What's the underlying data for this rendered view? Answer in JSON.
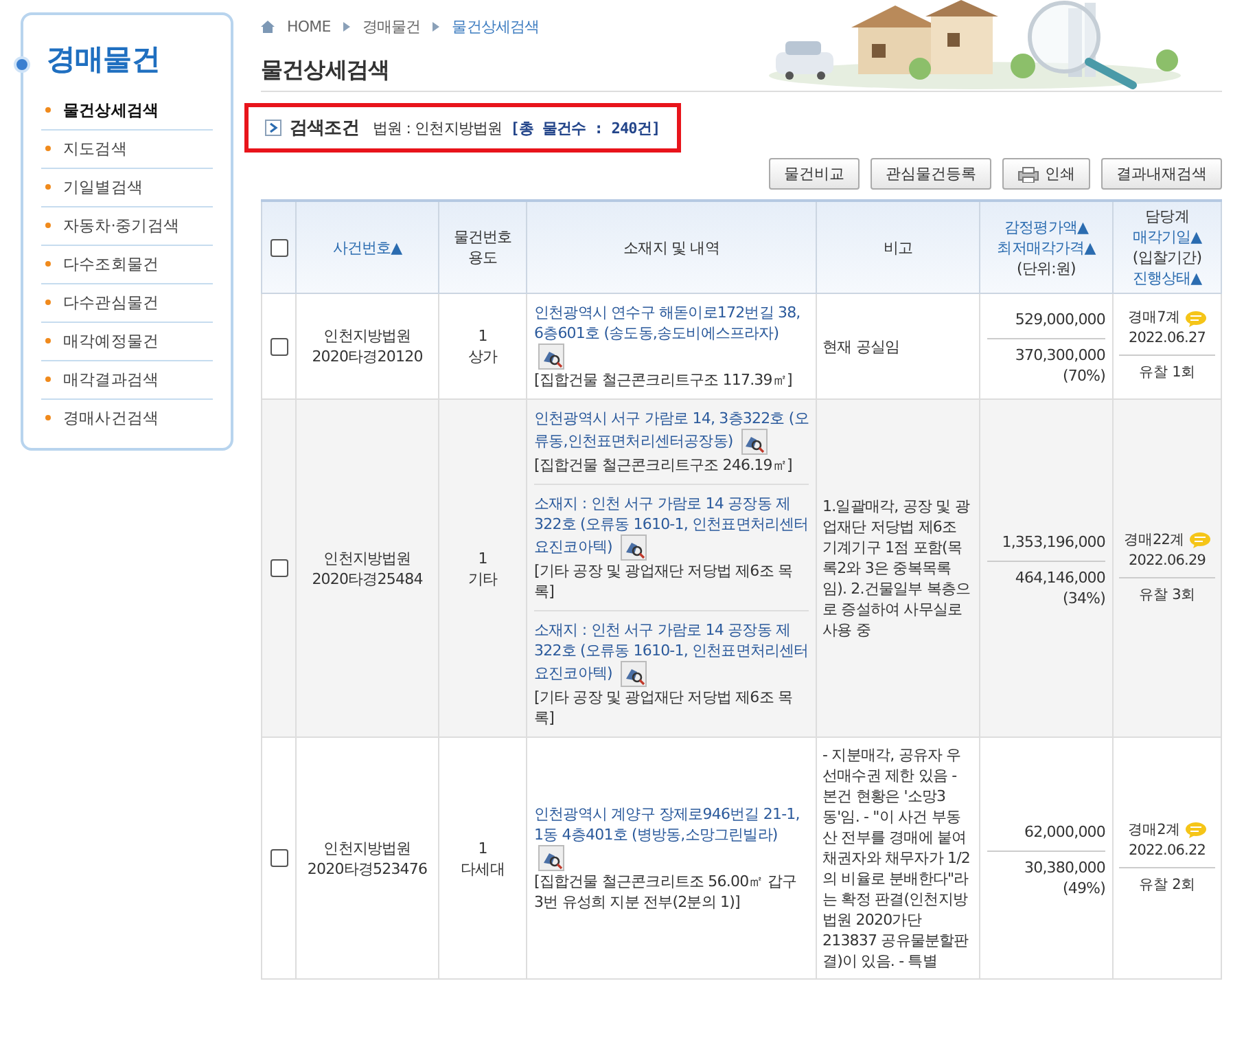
{
  "sidebar": {
    "title": "경매물건",
    "items": [
      {
        "label": "물건상세검색",
        "selected": true
      },
      {
        "label": "지도검색",
        "selected": false
      },
      {
        "label": "기일별검색",
        "selected": false
      },
      {
        "label": "자동차·중기검색",
        "selected": false
      },
      {
        "label": "다수조회물건",
        "selected": false
      },
      {
        "label": "다수관심물건",
        "selected": false
      },
      {
        "label": "매각예정물건",
        "selected": false
      },
      {
        "label": "매각결과검색",
        "selected": false
      },
      {
        "label": "경매사건검색",
        "selected": false
      }
    ]
  },
  "breadcrumb": [
    "HOME",
    "경매물건",
    "물건상세검색"
  ],
  "page_title": "물건상세검색",
  "search_condition": {
    "label": "검색조건",
    "court": "법원 : 인천지방법원",
    "total": "[총 물건수 : 240건]"
  },
  "toolbar": [
    {
      "label": "물건비교",
      "kind": "plain"
    },
    {
      "label": "관심물건등록",
      "kind": "plain"
    },
    {
      "label": "인쇄",
      "kind": "print"
    },
    {
      "label": "결과내재검색",
      "kind": "plain"
    }
  ],
  "table": {
    "select_all": {
      "checked": false
    },
    "columns": [
      {
        "kind": "check"
      },
      {
        "kind": "text",
        "lines": [
          {
            "text": "사건번호▲",
            "sortable": true
          }
        ]
      },
      {
        "kind": "text",
        "lines": [
          {
            "text": "물건번호",
            "sortable": false
          },
          {
            "text": "용도",
            "sortable": false
          }
        ]
      },
      {
        "kind": "text",
        "lines": [
          {
            "text": "소재지 및 내역",
            "sortable": false
          }
        ]
      },
      {
        "kind": "text",
        "lines": [
          {
            "text": "비고",
            "sortable": false
          }
        ]
      },
      {
        "kind": "text",
        "lines": [
          {
            "text": "감정평가액▲",
            "sortable": true
          },
          {
            "text": "최저매각가격▲",
            "sortable": true
          },
          {
            "text": "(단위:원)",
            "sortable": false
          }
        ]
      },
      {
        "kind": "text",
        "lines": [
          {
            "text": "담당계",
            "sortable": false
          },
          {
            "text": "매각기일▲",
            "sortable": true
          },
          {
            "text": "(입찰기간)",
            "sortable": false
          },
          {
            "text": "진행상태▲",
            "sortable": true
          }
        ]
      }
    ],
    "rows": [
      {
        "checked": false,
        "court": "인천지방법원",
        "case_no": "2020타경20120",
        "item_no": "1",
        "use": "상가",
        "addresses": [
          {
            "address": "인천광역시 연수구 해돋이로172번길 38, 6층601호 (송도동,송도비에스프라자)",
            "detail": "[집합건물 철근콘크리트구조 117.39㎡]"
          }
        ],
        "remark": "현재 공실임",
        "appraisal": "529,000,000",
        "minimum": "370,300,000",
        "ratio": "(70%)",
        "dept": "경매7계",
        "date": "2022.06.27",
        "status": "유찰 1회"
      },
      {
        "checked": false,
        "court": "인천지방법원",
        "case_no": "2020타경25484",
        "item_no": "1",
        "use": "기타",
        "addresses": [
          {
            "address": "인천광역시 서구 가람로 14, 3층322호 (오류동,인천표면처리센터공장동)",
            "detail": "[집합건물 철근콘크리트구조 246.19㎡]"
          },
          {
            "address": "소재지 : 인천 서구 가람로 14 공장동 제322호 (오류동 1610-1, 인천표면처리센터요진코아텍)",
            "detail": "[기타 공장 및 광업재단 저당법 제6조 목록]"
          },
          {
            "address": "소재지 : 인천 서구 가람로 14 공장동 제322호 (오류동 1610-1, 인천표면처리센터요진코아텍)",
            "detail": "[기타 공장 및 광업재단 저당법 제6조 목록]"
          }
        ],
        "remark": "1.일괄매각, 공장 및 광업재단 저당법 제6조 기계기구 1점 포함(목록2와 3은 중복목록임). 2.건물일부 복층으로 증설하여 사무실로 사용 중",
        "appraisal": "1,353,196,000",
        "minimum": "464,146,000",
        "ratio": "(34%)",
        "dept": "경매22계",
        "date": "2022.06.29",
        "status": "유찰 3회"
      },
      {
        "checked": false,
        "court": "인천지방법원",
        "case_no": "2020타경523476",
        "item_no": "1",
        "use": "다세대",
        "addresses": [
          {
            "address": "인천광역시 계양구 장제로946번길 21-1, 1동 4층401호 (병방동,소망그린빌라)",
            "detail": "[집합건물 철근콘크리트조 56.00㎡ 갑구 3번 유성희 지분 전부(2분의 1)]"
          }
        ],
        "remark": "- 지분매각, 공유자 우선매수권 제한 있음 - 본건 현황은 '소망3동'임. - \"이 사건 부동산 전부를 경매에 붙여 채권자와 채무자가 1/2의 비율로 분배한다\"라는 확정 판결(인천지방법원 2020가단213837 공유물분할판결)이 있음. - 특별",
        "appraisal": "62,000,000",
        "minimum": "30,380,000",
        "ratio": "(49%)",
        "dept": "경매2계",
        "date": "2022.06.22",
        "status": "유찰 2회"
      }
    ]
  }
}
